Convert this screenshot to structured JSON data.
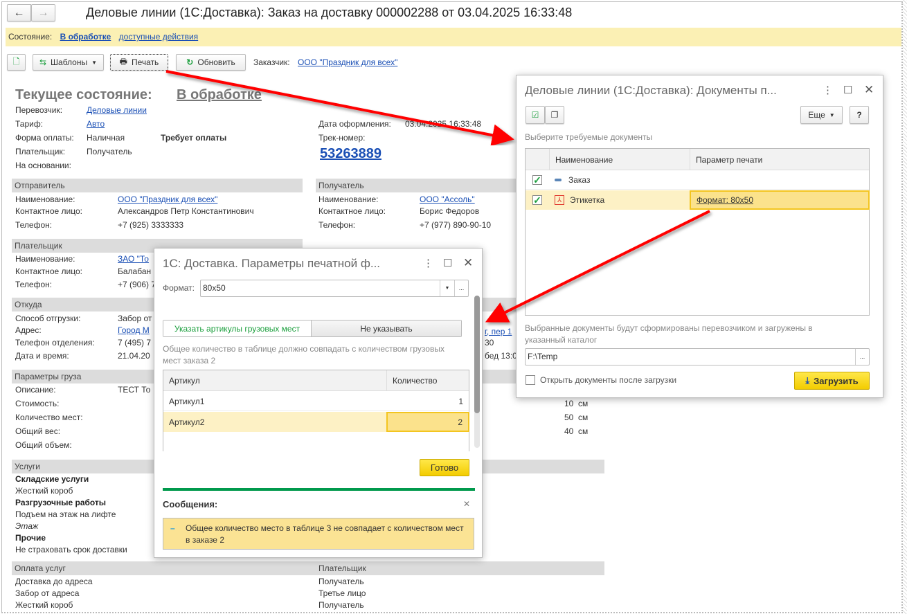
{
  "window": {
    "title": "Деловые линии (1С:Доставка): Заказ на доставку 000002288 от 03.04.2025 16:33:48"
  },
  "status_bar": {
    "label": "Состояние:",
    "value": "В обработке",
    "actions": "доступные действия"
  },
  "toolbar": {
    "templates": "Шаблоны",
    "print": "Печать",
    "refresh": "Обновить",
    "customer_label": "Заказчик:",
    "customer": "ООО \"Праздник для всех\""
  },
  "header": {
    "title": "Текущее состояние:",
    "state": "В обработке",
    "fields": [
      {
        "label": "Перевозчик:",
        "value": "Деловые линии",
        "link": true
      },
      {
        "label": "Тариф:",
        "value": "Авто",
        "link": true
      },
      {
        "label": "Форма оплаты:",
        "value": "Наличная",
        "extra": "Требует оплаты"
      },
      {
        "label": "Плательщик:",
        "value": "Получатель"
      },
      {
        "label": "На основании:",
        "value": ""
      }
    ],
    "date_label": "Дата оформления:",
    "date": "03.04.2025 16:33:48",
    "track_label": "Трек-номер:",
    "track": "53263889"
  },
  "sender": {
    "title": "Отправитель",
    "rows": [
      [
        "Наименование:",
        "ООО \"Праздник для всех\""
      ],
      [
        "Контактное лицо:",
        "Александров Петр Константинович"
      ],
      [
        "Телефон:",
        "+7 (925) 3333333"
      ]
    ]
  },
  "receiver": {
    "title": "Получатель",
    "rows": [
      [
        "Наименование:",
        "ООО \"Ассоль\""
      ],
      [
        "Контактное лицо:",
        "Борис Федоров"
      ],
      [
        "Телефон:",
        "+7 (977) 890-90-10"
      ]
    ]
  },
  "payer": {
    "title": "Плательщик",
    "rows": [
      [
        "Наименование:",
        "ЗАО \"То"
      ],
      [
        "Контактное лицо:",
        "Балабан"
      ],
      [
        "Телефон:",
        "+7 (906) 7"
      ]
    ]
  },
  "from": {
    "title": "Откуда",
    "rows": [
      [
        "Способ отгрузки:",
        "Забор от"
      ],
      [
        "Адрес:",
        "Город М"
      ],
      [
        "Телефон отделения:",
        "7 (495) 7"
      ],
      [
        "Дата и время:",
        "21.04.20"
      ]
    ],
    "right_fragments": [
      "г, пер 1",
      "30",
      "бед 13:0"
    ]
  },
  "cargo": {
    "title": "Параметры груза",
    "rows": [
      [
        "Описание:",
        "ТЕСТ То"
      ],
      [
        "Стоимость:",
        ""
      ],
      [
        "Количество мест:",
        ""
      ],
      [
        "Общий вес:",
        ""
      ],
      [
        "Общий объем:",
        ""
      ]
    ],
    "dims": [
      "10  см",
      "50  см",
      "40  см"
    ]
  },
  "services": {
    "title": "Услуги",
    "items": [
      {
        "text": "Складские услуги",
        "style": "bold"
      },
      {
        "text": "Жесткий короб"
      },
      {
        "text": "Разгрузочные работы",
        "style": "bold"
      },
      {
        "text": "Подъем на этаж на лифте"
      },
      {
        "text": "Этаж",
        "style": "italic"
      },
      {
        "text": "Прочие",
        "style": "bold"
      },
      {
        "text": "Не страховать срок доставки"
      }
    ]
  },
  "payment": {
    "title": "Оплата услуг",
    "payer_header": "Плательщик",
    "rows": [
      [
        "Доставка до адреса",
        "Получатель"
      ],
      [
        "Забор от адреса",
        "Третье лицо"
      ],
      [
        "Жесткий короб",
        "Получатель"
      ]
    ]
  },
  "params_dialog": {
    "title": "1С: Доставка. Параметры печатной ф...",
    "format_label": "Формат:",
    "format_value": "80x50",
    "toggle_specify": "Указать артикулы грузовых мест",
    "toggle_none": "Не указывать",
    "note": "Общее количество в таблице  должно совпадать с количеством грузовых мест заказа 2",
    "columns": [
      "Артикул",
      "Количество"
    ],
    "rows": [
      [
        "Артикул1",
        "1"
      ],
      [
        "Артикул2",
        "2"
      ]
    ],
    "done": "Готово",
    "messages_title": "Сообщения:",
    "message": "Общее количество место в таблице 3 не совпадает с количеством мест в заказе 2"
  },
  "docs_dialog": {
    "title": "Деловые линии (1С:Доставка): Документы п...",
    "more": "Еще",
    "help": "?",
    "hint": "Выберите требуемые документы",
    "columns": [
      "Наименование",
      "Параметр печати"
    ],
    "rows": [
      {
        "checked": true,
        "name": "Заказ",
        "param": ""
      },
      {
        "checked": true,
        "name": "Этикетка",
        "param": "Формат: 80x50"
      }
    ],
    "note": "Выбранные документы будут сформированы перевозчиком и загружены в указанный каталог",
    "path": "F:\\Temp",
    "open_after": "Открыть документы после загрузки",
    "open_after_checked": false,
    "upload": "Загрузить"
  },
  "colors": {
    "accent_yellow": "#f5d316",
    "status_bar": "#fbf0b4",
    "link": "#1a4fb5",
    "arrow": "#ff0000",
    "green": "#00994c"
  }
}
